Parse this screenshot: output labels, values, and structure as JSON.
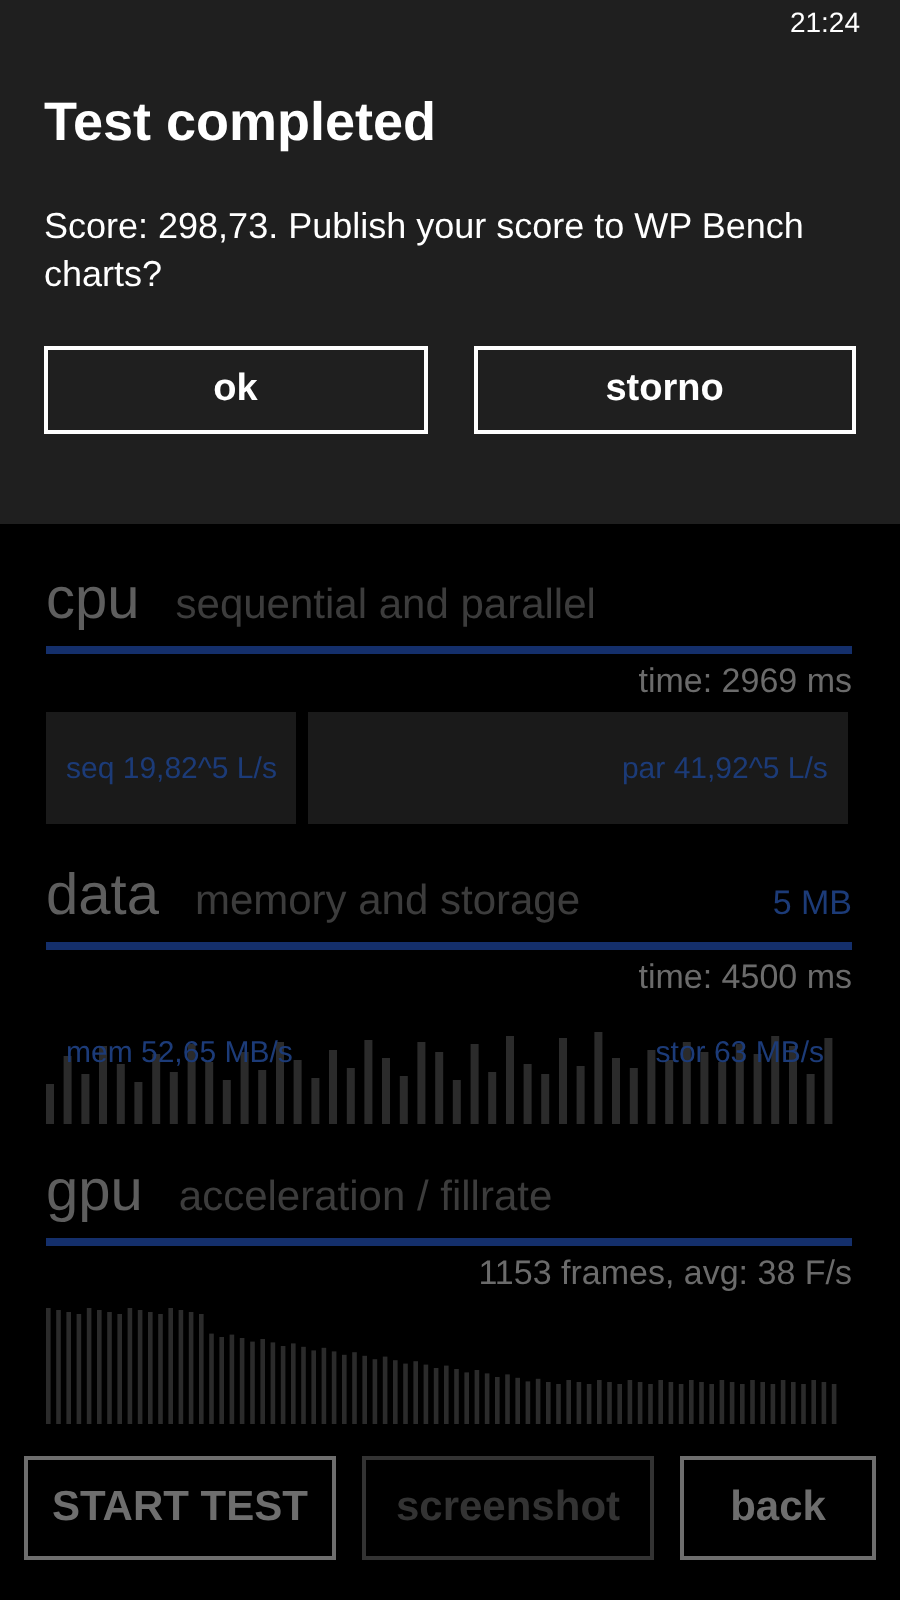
{
  "status_bar": {
    "time": "21:24"
  },
  "dialog": {
    "title": "Test completed",
    "message": "Score: 298,73. Publish your score to WP Bench charts?",
    "buttons": [
      "ok",
      "storno"
    ]
  },
  "sections": [
    {
      "kind": "split",
      "title": "cpu",
      "subtitle": "sequential and parallel",
      "stat": "time: 2969 ms",
      "results": [
        {
          "label": "seq 19,82^5 L/s"
        },
        {
          "label": "par 41,92^5 L/s"
        }
      ]
    },
    {
      "kind": "bars-labeled",
      "title": "data",
      "subtitle": "memory and storage",
      "size": "5 MB",
      "stat": "time: 4500 ms",
      "results": [
        {
          "label": "mem 52,65 MB/s"
        },
        {
          "label": "stor 63 MB/s"
        }
      ]
    },
    {
      "kind": "bars-falling",
      "title": "gpu",
      "subtitle": "acceleration / fillrate",
      "stat": "1153 frames, avg: 38 F/s"
    }
  ],
  "app_bar": [
    {
      "label": "START TEST",
      "disabled": false
    },
    {
      "label": "screenshot",
      "disabled": true
    },
    {
      "label": "back",
      "disabled": false
    }
  ]
}
